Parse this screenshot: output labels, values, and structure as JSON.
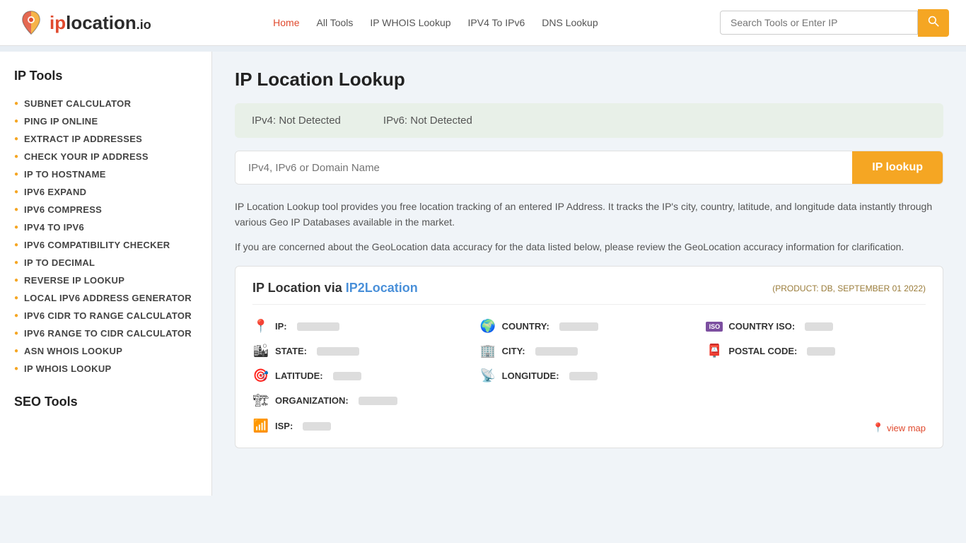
{
  "logo": {
    "text_ip": "ip",
    "text_location": "location",
    "text_io": ".io"
  },
  "nav": {
    "items": [
      {
        "label": "Home",
        "active": true
      },
      {
        "label": "All Tools",
        "active": false
      },
      {
        "label": "IP WHOIS Lookup",
        "active": false
      },
      {
        "label": "IPV4 To IPv6",
        "active": false
      },
      {
        "label": "DNS Lookup",
        "active": false
      }
    ]
  },
  "search": {
    "placeholder": "Search Tools or Enter IP",
    "button_icon": "🔍"
  },
  "sidebar": {
    "ip_tools_title": "IP Tools",
    "ip_tools": [
      {
        "label": "SUBNET CALCULATOR"
      },
      {
        "label": "PING IP ONLINE"
      },
      {
        "label": "EXTRACT IP ADDRESSES"
      },
      {
        "label": "CHECK YOUR IP ADDRESS"
      },
      {
        "label": "IP TO HOSTNAME"
      },
      {
        "label": "IPV6 EXPAND"
      },
      {
        "label": "IPV6 COMPRESS"
      },
      {
        "label": "IPV4 TO IPV6"
      },
      {
        "label": "IPV6 COMPATIBILITY CHECKER"
      },
      {
        "label": "IP TO DECIMAL"
      },
      {
        "label": "REVERSE IP LOOKUP"
      },
      {
        "label": "LOCAL IPV6 ADDRESS GENERATOR"
      },
      {
        "label": "IPV6 CIDR TO RANGE CALCULATOR"
      },
      {
        "label": "IPV6 RANGE TO CIDR CALCULATOR"
      },
      {
        "label": "ASN WHOIS LOOKUP"
      },
      {
        "label": "IP WHOIS LOOKUP"
      }
    ],
    "seo_tools_title": "SEO Tools"
  },
  "main": {
    "page_title": "IP Location Lookup",
    "ip_v4_label": "IPv4: Not Detected",
    "ip_v6_label": "IPv6: Not Detected",
    "lookup_placeholder": "IPv4, IPv6 or Domain Name",
    "lookup_button": "IP lookup",
    "description_1": "IP Location Lookup tool provides you free location tracking of an entered IP Address. It tracks the IP's city, country, latitude, and longitude data instantly through various Geo IP Databases available in the market.",
    "description_2": "If you are concerned about the GeoLocation data accuracy for the data listed below, please review the GeoLocation accuracy information for clarification.",
    "results_card": {
      "title_prefix": "IP Location via ",
      "title_link": "IP2Location",
      "meta": "(PRODUCT: DB, SEPTEMBER 01 2022)",
      "fields": [
        {
          "icon": "📍",
          "label": "IP:",
          "value_width": 50
        },
        {
          "icon": "🌍",
          "label": "COUNTRY:",
          "value_width": 55
        },
        {
          "icon": "🔲",
          "label": "COUNTRY ISO:",
          "value_width": 45
        },
        {
          "icon": "🏙",
          "label": "STATE:",
          "value_width": 50
        },
        {
          "icon": "🏢",
          "label": "CITY:",
          "value_width": 50
        },
        {
          "icon": "📮",
          "label": "POSTAL CODE:",
          "value_width": 45
        },
        {
          "icon": "🎯",
          "label": "LATITUDE:",
          "value_width": 40
        },
        {
          "icon": "📡",
          "label": "LONGITUDE:",
          "value_width": 45
        }
      ],
      "org_label": "ORGANIZATION:",
      "isp_label": "ISP:",
      "view_map": "view map"
    }
  }
}
